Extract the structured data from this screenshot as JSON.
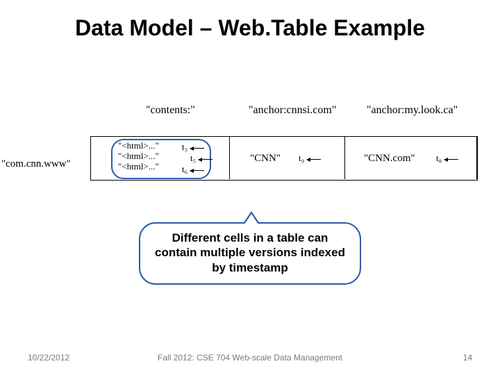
{
  "title": "Data Model – Web.Table Example",
  "columns": {
    "contents": "\"contents:\"",
    "anchor1": "\"anchor:cnnsi.com\"",
    "anchor2": "\"anchor:my.look.ca\""
  },
  "row_key": "\"com.cnn.www\"",
  "contents_versions": {
    "v1": "\"<html>...\"",
    "v2": "\"<html>...\"",
    "v3": "\"<html>...\""
  },
  "timestamps": {
    "t3": "t₃",
    "t5": "t₅",
    "t6": "t₆",
    "t9": "t₉",
    "t8": "t₈"
  },
  "anchor_values": {
    "cnn": "\"CNN\"",
    "cnncom": "\"CNN.com\""
  },
  "callout": "Different cells in a table can contain multiple versions indexed by timestamp",
  "footer": {
    "date": "10/22/2012",
    "center": "Fall 2012: CSE 704 Web-scale Data Management",
    "page": "14"
  }
}
